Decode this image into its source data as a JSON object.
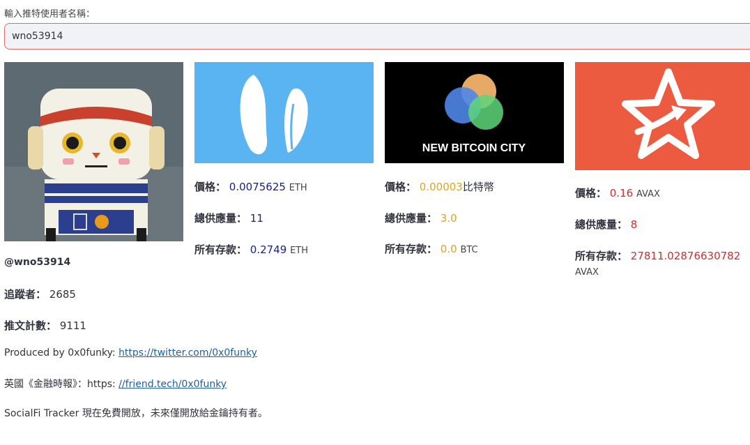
{
  "search": {
    "label": "輸入推特使用者名稱：",
    "value": "wno53914"
  },
  "profile": {
    "handle": "@wno53914",
    "followers_label": "追蹤者：",
    "followers_value": "2685",
    "tweets_label": "推文計數：",
    "tweets_value": "9111"
  },
  "footer": {
    "produced_prefix": "Produced by 0x0funky: ",
    "produced_link": "https://twitter.com/0x0funky",
    "ft_prefix": "英國《金融時報》：https: ",
    "ft_link": "//friend.tech/0x0funky",
    "notice": "SocialFi Tracker 現在免費開放，未來僅開放給金鑰持有者。"
  },
  "tokens": [
    {
      "logo_name": "rabbit-ears-logo",
      "price_label": "價格：",
      "price_value": "0.0075625",
      "price_unit": "ETH",
      "supply_label": "總供應量：",
      "supply_value": "11",
      "deposit_label": "所有存款：",
      "deposit_value": "0.2749",
      "deposit_unit": "ETH",
      "accent": "#1a237e"
    },
    {
      "logo_name": "new-bitcoin-city-logo",
      "logo_text": "NEW BITCOIN CITY",
      "price_label": "價格：",
      "price_value": "0.00003",
      "price_unit": "比特幣",
      "supply_label": "總供應量：",
      "supply_value": "3.0",
      "deposit_label": "所有存款：",
      "deposit_value": "0.0",
      "deposit_unit": "BTC",
      "accent": "#e0a31a"
    },
    {
      "logo_name": "star-arrow-logo",
      "price_label": "價格：",
      "price_value": "0.16",
      "price_unit": "AVAX",
      "supply_label": "總供應量：",
      "supply_value": "8",
      "deposit_label": "所有存款：",
      "deposit_value": "27811.02876630782",
      "deposit_unit": "AVAX",
      "accent": "#d42c2c"
    }
  ]
}
